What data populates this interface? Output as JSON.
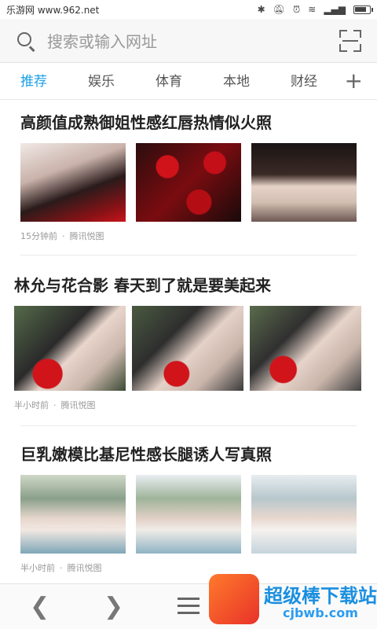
{
  "status_bar": {
    "site_label": "乐游网 www.962.net",
    "time": "",
    "icons": [
      "bluetooth-icon",
      "bell-off-icon",
      "alarm-icon",
      "wifi-icon",
      "signal-icon",
      "battery-icon"
    ],
    "battery_level": 0.8
  },
  "search": {
    "placeholder": "搜索或输入网址"
  },
  "tabs": [
    {
      "label": "推荐",
      "active": true
    },
    {
      "label": "娱乐",
      "active": false
    },
    {
      "label": "体育",
      "active": false
    },
    {
      "label": "本地",
      "active": false
    },
    {
      "label": "财经",
      "active": false
    }
  ],
  "tab_add": "+",
  "feed": [
    {
      "title": "高颜值成熟御姐性感红唇热情似火照",
      "time": "15分钟前",
      "source": "腾讯悦图"
    },
    {
      "title": "林允与花合影 春天到了就是要美起来",
      "time": "半小时前",
      "source": "腾讯悦图"
    },
    {
      "title": "巨乳嫩模比基尼性感长腿诱人写真照",
      "time": "半小时前",
      "source": "腾讯悦图"
    }
  ],
  "meta_separator": "·",
  "bottom_nav": {
    "back_icon": "chevron-left-icon",
    "forward_icon": "chevron-right-icon",
    "menu_icon": "menu-icon"
  },
  "watermark": {
    "text": "超级棒下载站",
    "url": "cjbwb.com"
  },
  "colors": {
    "accent": "#1aa0e6",
    "watermark_blue": "#1a8fe0"
  }
}
